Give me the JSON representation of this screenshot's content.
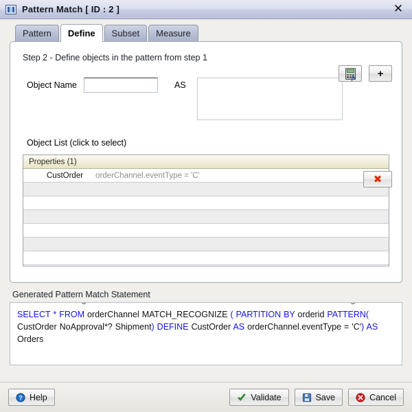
{
  "window": {
    "title": "Pattern Match [ ID : 2 ]",
    "icon": "pattern-match-icon",
    "close_label": "✕"
  },
  "tabs": [
    {
      "label": "Pattern",
      "active": false
    },
    {
      "label": "Define",
      "active": true
    },
    {
      "label": "Subset",
      "active": false
    },
    {
      "label": "Measure",
      "active": false
    }
  ],
  "panel": {
    "step_text": "Step 2 - Define objects in the pattern from step 1",
    "object_name_label": "Object Name",
    "object_name_value": "",
    "object_name_placeholder": "",
    "as_label": "AS",
    "as_value": "",
    "as_placeholder": "",
    "expression_button_icon": "calculator-fx-icon",
    "add_button_label": "+",
    "object_list_label": "Object List (click to select)",
    "delete_button_icon": "red-x-icon",
    "delete_button_label": "✖"
  },
  "table": {
    "header": "Properties (1)",
    "rows": [
      {
        "name": "CustOrder",
        "expression": "orderChannel.eventType = 'C'"
      },
      {
        "name": "",
        "expression": ""
      },
      {
        "name": "",
        "expression": ""
      },
      {
        "name": "",
        "expression": ""
      },
      {
        "name": "",
        "expression": ""
      },
      {
        "name": "",
        "expression": ""
      },
      {
        "name": "",
        "expression": ""
      }
    ]
  },
  "generated": {
    "label": "Generated Pattern Match Statement",
    "statement_plain": "SELECT * FROM orderChannel  MATCH_RECOGNIZE ( PARTITION BY orderid PATTERN( CustOrder NoApproval*? Shipment) DEFINE CustOrder AS orderChannel.eventType = 'C') AS Orders",
    "tokens": [
      {
        "t": "SELECT * FROM ",
        "kw": true
      },
      {
        "t": "orderChannel  MATCH_RECOGNIZE ",
        "kw": false
      },
      {
        "t": "( PARTITION BY ",
        "kw": true
      },
      {
        "t": "orderid ",
        "kw": false
      },
      {
        "t": "PATTERN(",
        "kw": true
      },
      {
        "t": " CustOrder NoApproval*? Shipment",
        "kw": false
      },
      {
        "t": ") DEFINE ",
        "kw": true
      },
      {
        "t": "CustOrder ",
        "kw": false
      },
      {
        "t": "AS ",
        "kw": true
      },
      {
        "t": "orderChannel.eventType = 'C'",
        "kw": false
      },
      {
        "t": ") ",
        "kw": true
      },
      {
        "t": "AS ",
        "kw": true
      },
      {
        "t": "Orders",
        "kw": false
      }
    ],
    "keyword_color": "#1313e0",
    "text_color": "#111111"
  },
  "footer": {
    "help_label": "Help",
    "validate_label": "Validate",
    "save_label": "Save",
    "cancel_label": "Cancel"
  }
}
